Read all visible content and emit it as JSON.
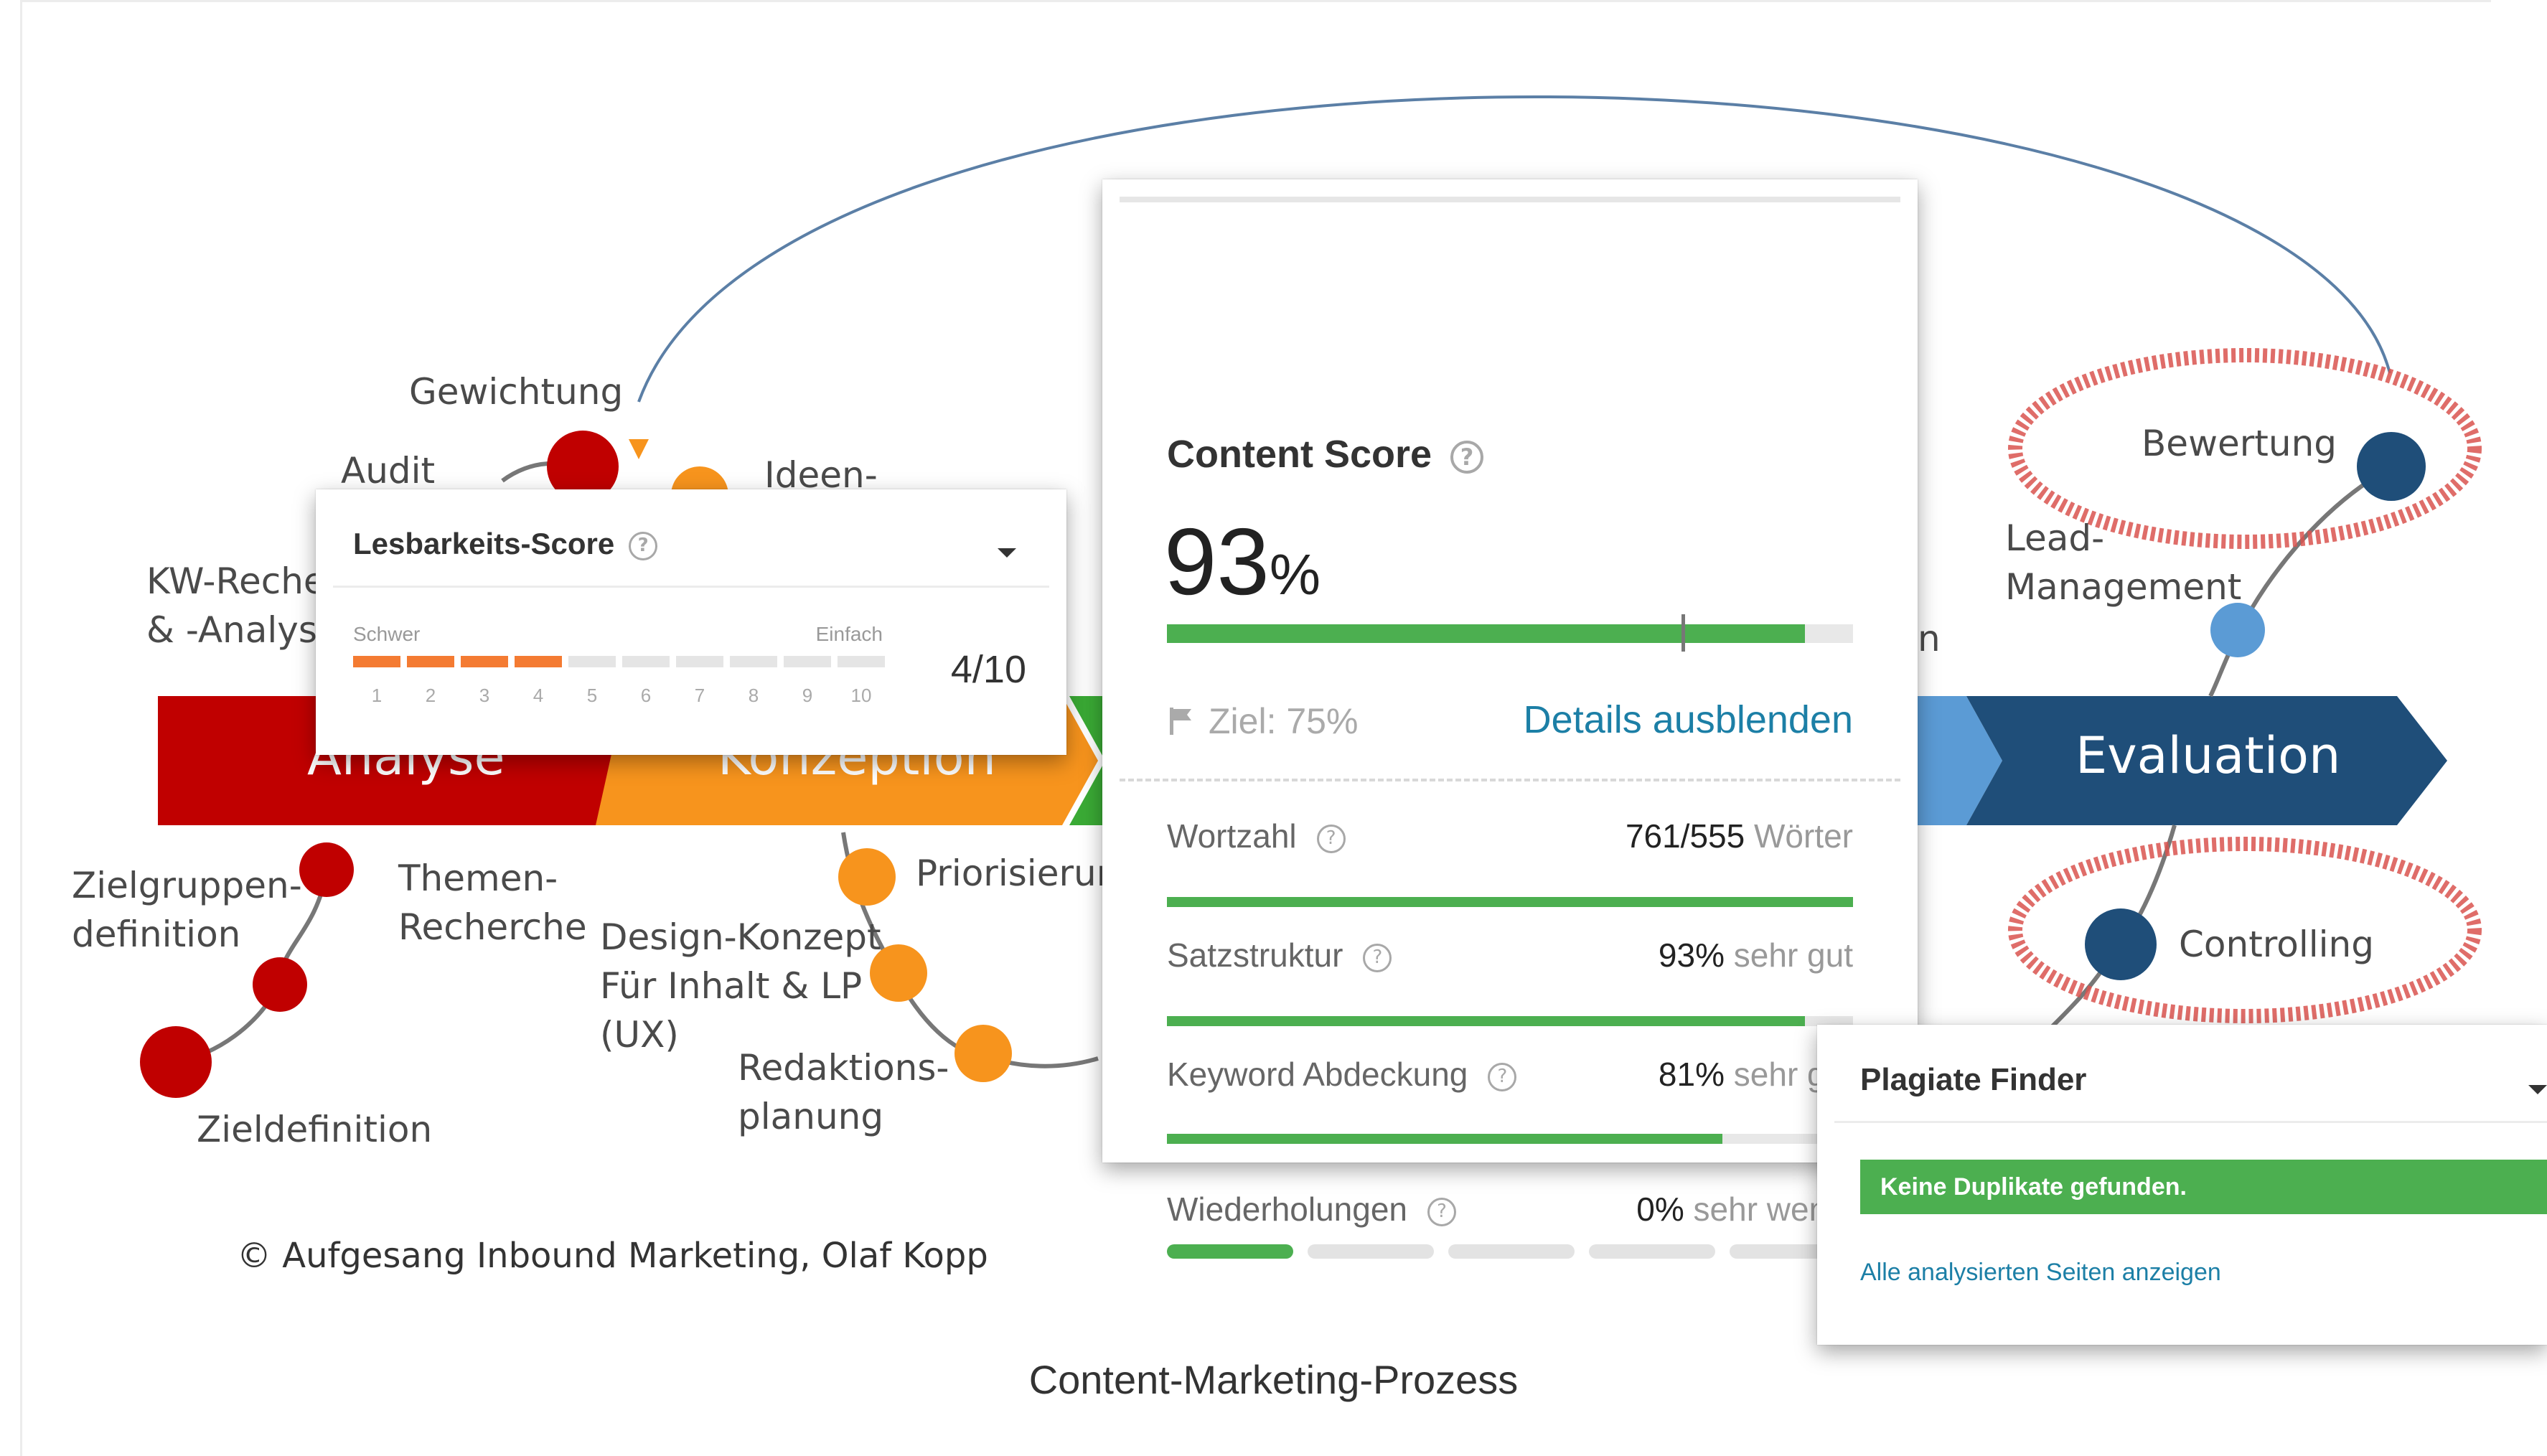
{
  "diagram": {
    "labels": {
      "gewichtung": "Gewichtung",
      "audit": "Audit",
      "ideen": "Ideen-",
      "kw_recherche": "KW-Recherche\n& -Analyse",
      "zielgruppen": "Zielgruppen-\ndefinition",
      "themen": "Themen-\nRecherche",
      "zieldefinition": "Zieldefinition",
      "design_konzept": "Design-Konzept\nFür Inhalt & LP\n(UX)",
      "priorisierung": "Priorisierung",
      "redaktion": "Redaktions-\nplanung",
      "bewertung": "Bewertung",
      "lead": "Lead-\nManagement",
      "controlling": "Controlling",
      "n_partial": "n"
    },
    "phases": {
      "analyse": "Analyse",
      "konzeption": "Konzeption",
      "evaluation": "Evaluation"
    },
    "colors": {
      "analyse": "#c00000",
      "konzeption": "#f7941d",
      "umsetzung": "#3aaa35",
      "distribution": "#5b9bd5",
      "evaluation": "#1f4e79",
      "highlight": "#d9534f"
    },
    "copyright": "© Aufgesang Inbound Marketing, Olaf Kopp",
    "caption": "Content-Marketing-Prozess"
  },
  "content_score": {
    "title": "Content Score",
    "help_icon": "question-circle-icon",
    "score": "93",
    "score_unit": "%",
    "score_fraction": 0.93,
    "goal_fraction": 0.75,
    "goal_label": "Ziel: 75%",
    "goal_icon": "flag-icon",
    "toggle_label": "Details ausblenden",
    "metrics": [
      {
        "label": "Wortzahl",
        "value": "761/555",
        "unit": "Wörter",
        "fraction": 1.0
      },
      {
        "label": "Satzstruktur",
        "value": "93%",
        "unit": "sehr gut",
        "fraction": 0.93
      },
      {
        "label": "Keyword Abdeckung",
        "value": "81%",
        "unit": "sehr gut",
        "fraction": 0.81
      }
    ],
    "repetition": {
      "label": "Wiederholungen",
      "value": "0%",
      "unit": "sehr wenig",
      "segments_total": 5,
      "segments_filled": 1
    }
  },
  "readability": {
    "title": "Lesbarkeits-Score",
    "low_label": "Schwer",
    "high_label": "Einfach",
    "scale": [
      "1",
      "2",
      "3",
      "4",
      "5",
      "6",
      "7",
      "8",
      "9",
      "10"
    ],
    "value": 4,
    "score_text": "4/10",
    "accent": "#f47b32"
  },
  "plagiarism": {
    "title": "Plagiate Finder",
    "status": "Keine Duplikate gefunden.",
    "link": "Alle analysierten Seiten anzeigen"
  }
}
